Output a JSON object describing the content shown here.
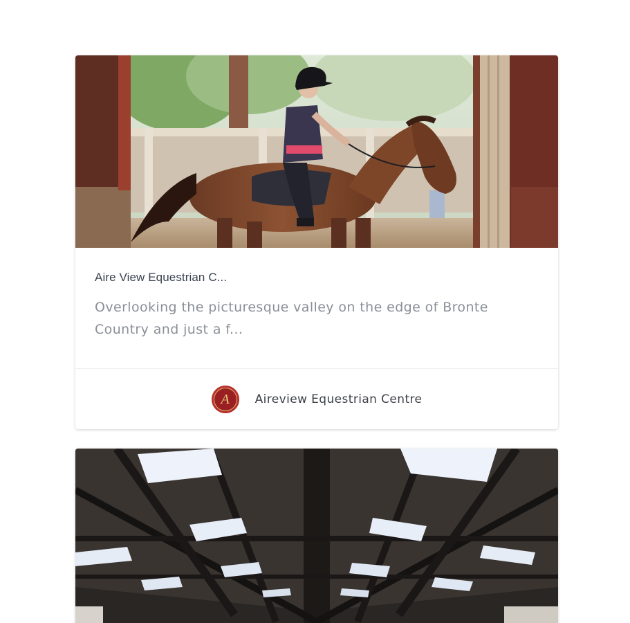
{
  "cards": [
    {
      "title": "Aire View Equestrian C...",
      "description": "Overlooking the picturesque valley on the edge of Bronte Country and just a f...",
      "author": {
        "name": "Aireview Equestrian Centre",
        "avatar_letter": "A",
        "avatar_color": "#9a1f22"
      },
      "image": "photo-girl-riding-horse"
    },
    {
      "image": "photo-indoor-arena-roof"
    }
  ]
}
